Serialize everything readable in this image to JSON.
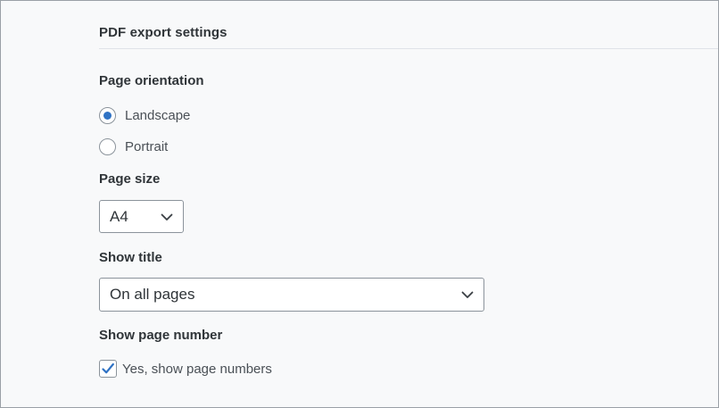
{
  "section": {
    "title": "PDF export settings"
  },
  "orientation": {
    "label": "Page orientation",
    "options": [
      {
        "label": "Landscape",
        "selected": true
      },
      {
        "label": "Portrait",
        "selected": false
      }
    ]
  },
  "page_size": {
    "label": "Page size",
    "value": "A4",
    "icon": "chevron-down-icon"
  },
  "show_title": {
    "label": "Show title",
    "value": "On all pages",
    "icon": "chevron-down-icon"
  },
  "page_number": {
    "label": "Show page number",
    "checkbox_label": "Yes, show page numbers",
    "checked": true
  },
  "colors": {
    "accent": "#2f72c4",
    "border": "#8b939b",
    "background": "#f8f9fa"
  }
}
